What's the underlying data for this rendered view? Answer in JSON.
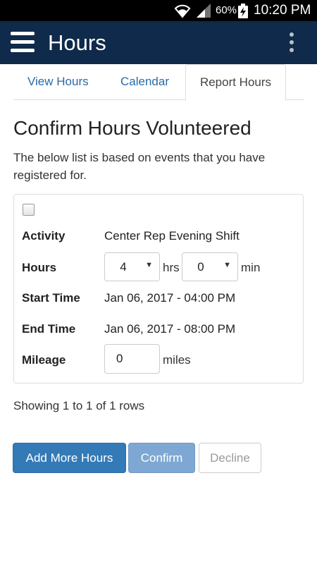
{
  "status_bar": {
    "battery_percent": "60%",
    "time": "10:20 PM",
    "icons": [
      "wifi-icon",
      "signal-icon",
      "battery-charging-icon"
    ]
  },
  "app_bar": {
    "title": "Hours",
    "menu_icon": "hamburger-menu-icon",
    "overflow_icon": "more-vert-icon",
    "background_color": "#0f2a4a"
  },
  "tabs": [
    {
      "label": "View Hours",
      "active": false
    },
    {
      "label": "Calendar",
      "active": false
    },
    {
      "label": "Report Hours",
      "active": true
    }
  ],
  "page": {
    "heading": "Confirm Hours Volunteered",
    "intro": "The below list is based on events that you have registered for."
  },
  "entry": {
    "checked": false,
    "activity_label": "Activity",
    "activity_value": "Center Rep Evening Shift",
    "hours_label": "Hours",
    "hours_value": "4",
    "hours_unit": "hrs",
    "minutes_value": "0",
    "minutes_unit": "min",
    "start_label": "Start Time",
    "start_value": "Jan 06, 2017 - 04:00 PM",
    "end_label": "End Time",
    "end_value": "Jan 06, 2017 - 08:00 PM",
    "mileage_label": "Mileage",
    "mileage_value": "0",
    "mileage_unit": "miles"
  },
  "pagination": {
    "text": "Showing 1 to 1 of 1 rows"
  },
  "actions": {
    "add_more": "Add More Hours",
    "confirm": "Confirm",
    "decline": "Decline",
    "primary_color": "#337ab7"
  }
}
